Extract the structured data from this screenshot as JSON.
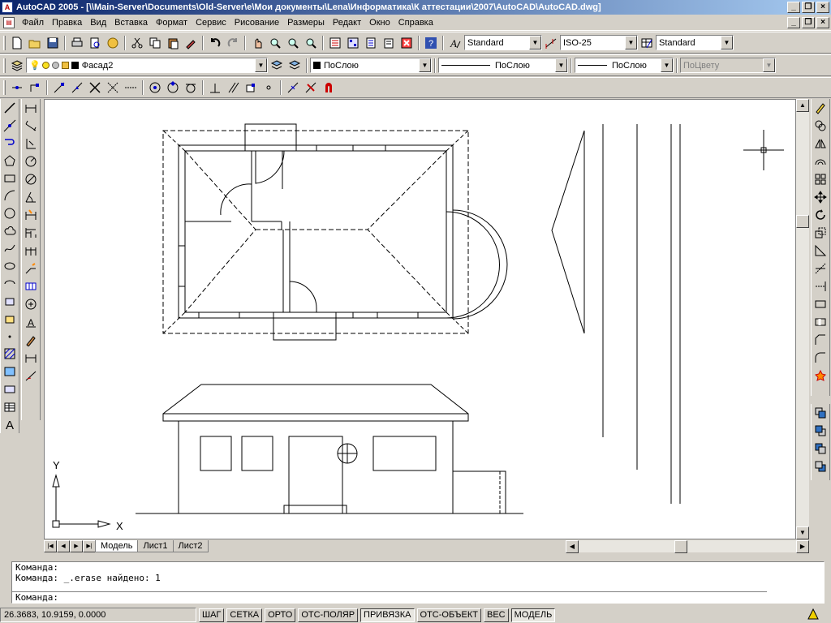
{
  "window": {
    "title": "AutoCAD 2005 - [\\\\Main-Server\\Documents\\Old-Server\\e\\Мои документы\\Lena\\Информатика\\К аттестации\\2007\\AutoCAD\\AutoCAD.dwg]"
  },
  "menu": [
    "Файл",
    "Правка",
    "Вид",
    "Вставка",
    "Формат",
    "Сервис",
    "Рисование",
    "Размеры",
    "Редакт",
    "Окно",
    "Справка"
  ],
  "toolbar_styles": {
    "text_style": "Standard",
    "dim_style": "ISO-25",
    "table_style": "Standard"
  },
  "layers": {
    "current_layer": "Фасад2",
    "color": "ПоСлою",
    "linetype": "ПоСлою",
    "lineweight": "ПоСлою",
    "plotstyle": "ПоЦвету"
  },
  "axis": {
    "x": "X",
    "y": "Y"
  },
  "tabs": [
    "Модель",
    "Лист1",
    "Лист2"
  ],
  "command": {
    "lines": [
      "Команда:",
      "Команда: _.erase найдено: 1"
    ],
    "prompt": "Команда:"
  },
  "status": {
    "coords": "26.3683, 10.9159, 0.0000",
    "buttons": [
      "ШАГ",
      "СЕТКА",
      "ОРТО",
      "ОТС-ПОЛЯР",
      "ПРИВЯЗКА",
      "ОТС-ОБЪЕКТ",
      "ВЕС",
      "МОДЕЛЬ"
    ],
    "active": [
      "ПРИВЯЗКА",
      "МОДЕЛЬ"
    ]
  }
}
